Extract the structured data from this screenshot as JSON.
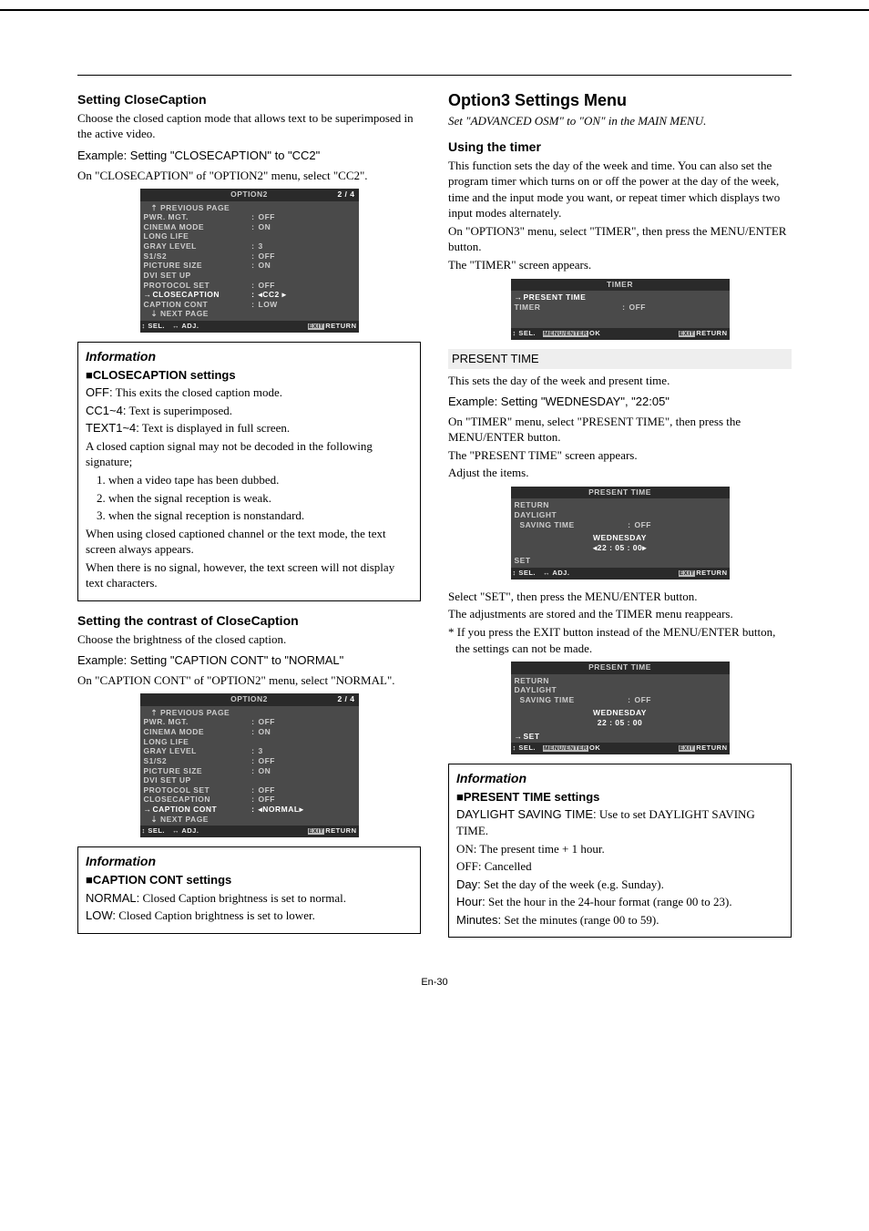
{
  "left": {
    "closeCaption": {
      "heading": "Setting CloseCaption",
      "intro": "Choose the closed caption mode that allows text to be superimposed in the active video.",
      "example": "Example: Setting \"CLOSECAPTION\" to \"CC2\"",
      "instruction": "On \"CLOSECAPTION\" of \"OPTION2\" menu, select \"CC2\"."
    },
    "osd1": {
      "title": "OPTION2",
      "page": "2 / 4",
      "prev": "PREVIOUS PAGE",
      "rows": [
        {
          "label": "PWR. MGT.",
          "val": "OFF"
        },
        {
          "label": "CINEMA MODE",
          "val": "ON"
        },
        {
          "label": "LONG LIFE",
          "val": ""
        },
        {
          "label": "GRAY LEVEL",
          "val": "3"
        },
        {
          "label": "S1/S2",
          "val": "OFF"
        },
        {
          "label": "PICTURE SIZE",
          "val": "ON"
        },
        {
          "label": "DVI SET UP",
          "val": ""
        },
        {
          "label": "PROTOCOL SET",
          "val": "OFF"
        },
        {
          "label": "CLOSECAPTION",
          "val": "◂CC2   ▸",
          "sel": true
        },
        {
          "label": "CAPTION CONT",
          "val": "LOW"
        }
      ],
      "next": "NEXT PAGE",
      "foot": {
        "sel": "SEL.",
        "adj": "ADJ.",
        "ret": "RETURN"
      }
    },
    "info1": {
      "title": "Information",
      "subtitle": "CLOSECAPTION settings",
      "l1a": "OFF:",
      "l1b": " This exits the closed caption mode.",
      "l2a": "CC1~4:",
      "l2b": " Text is superimposed.",
      "l3a": "TEXT1~4:",
      "l3b": " Text is displayed in full screen.",
      "l4": "A closed caption signal may not be decoded in the following signature;",
      "li1": "1. when a video tape has been dubbed.",
      "li2": "2. when the signal reception is weak.",
      "li3": "3. when the signal reception is nonstandard.",
      "l5": "When using closed captioned channel or the text mode, the text screen always appears.",
      "l6": "When there is no signal, however, the text screen will not display text characters."
    },
    "contrast": {
      "heading": "Setting the contrast of CloseCaption",
      "intro": "Choose the brightness of the closed caption.",
      "example": "Example: Setting \"CAPTION CONT\" to \"NORMAL\"",
      "instruction": "On \"CAPTION CONT\" of \"OPTION2\" menu, select \"NORMAL\"."
    },
    "osd2": {
      "title": "OPTION2",
      "page": "2 / 4",
      "prev": "PREVIOUS PAGE",
      "rows": [
        {
          "label": "PWR. MGT.",
          "val": "OFF"
        },
        {
          "label": "CINEMA MODE",
          "val": "ON"
        },
        {
          "label": "LONG LIFE",
          "val": ""
        },
        {
          "label": "GRAY LEVEL",
          "val": "3"
        },
        {
          "label": "S1/S2",
          "val": "OFF"
        },
        {
          "label": "PICTURE SIZE",
          "val": "ON"
        },
        {
          "label": "DVI SET UP",
          "val": ""
        },
        {
          "label": "PROTOCOL SET",
          "val": "OFF"
        },
        {
          "label": "CLOSECAPTION",
          "val": "OFF"
        },
        {
          "label": "CAPTION CONT",
          "val": "◂NORMAL▸",
          "sel": true
        }
      ],
      "next": "NEXT PAGE",
      "foot": {
        "sel": "SEL.",
        "adj": "ADJ.",
        "ret": "RETURN"
      }
    },
    "info2": {
      "title": "Information",
      "subtitle": "CAPTION CONT settings",
      "l1a": "NORMAL:",
      "l1b": " Closed Caption brightness is set to normal.",
      "l2a": "LOW:",
      "l2b": " Closed Caption brightness is set to lower."
    }
  },
  "right": {
    "menuTitle": "Option3 Settings Menu",
    "advanced": "Set \"ADVANCED OSM\" to \"ON\" in the MAIN MENU.",
    "timer": {
      "heading": "Using the timer",
      "p1": "This function sets the day of the week and time. You can also set the program timer which turns on or off the power at the day of the week, time and the input mode you want, or repeat timer which displays two input modes alternately.",
      "p2": "On \"OPTION3\" menu, select \"TIMER\", then press the MENU/ENTER button.",
      "p3": "The \"TIMER\" screen appears."
    },
    "osd3": {
      "title": "TIMER",
      "rows": [
        {
          "label": "PRESENT TIME",
          "sel": true
        },
        {
          "label": "TIMER",
          "val": "OFF"
        }
      ],
      "foot": {
        "sel": "SEL.",
        "ok": "OK",
        "ret": "RETURN"
      }
    },
    "presentHead": "PRESENT TIME",
    "present": {
      "p1": "This sets the day of the week and present time.",
      "example": "Example: Setting \"WEDNESDAY\", \"22:05\"",
      "p2": "On \"TIMER\" menu, select \"PRESENT TIME\", then press the MENU/ENTER button.",
      "p3": "The \"PRESENT TIME\" screen appears.",
      "p4": "Adjust the items."
    },
    "osd4": {
      "title": "PRESENT TIME",
      "return": "RETURN",
      "dl1": "DAYLIGHT",
      "dl2": "SAVING TIME",
      "dlval": "OFF",
      "day": "WEDNESDAY",
      "time": "◂22 : 05 : 00▸",
      "set": "SET",
      "foot": {
        "sel": "SEL.",
        "adj": "ADJ.",
        "ret": "RETURN"
      }
    },
    "afterOsd4": {
      "p1": "Select \"SET\", then press the MENU/ENTER button.",
      "p2": "The adjustments are stored and the TIMER menu reappears.",
      "p3": "* If you press the EXIT button instead of the MENU/ENTER button, the settings can not be made."
    },
    "osd5": {
      "title": "PRESENT TIME",
      "return": "RETURN",
      "dl1": "DAYLIGHT",
      "dl2": "SAVING TIME",
      "dlval": "OFF",
      "day": "WEDNESDAY",
      "time": "22 : 05 : 00",
      "set": "SET",
      "foot": {
        "sel": "SEL.",
        "ok": "OK",
        "ret": "RETURN"
      }
    },
    "info3": {
      "title": "Information",
      "subtitle": "PRESENT TIME settings",
      "l1a": "DAYLIGHT SAVING TIME:",
      "l1b": " Use to set DAYLIGHT SAVING TIME.",
      "l2": "ON:    The present time + 1 hour.",
      "l3": "OFF:   Cancelled",
      "l4a": "Day:",
      "l4b": " Set the day of the week (e.g. Sunday).",
      "l5a": "Hour:",
      "l5b": " Set the hour in the 24-hour format (range 00 to 23).",
      "l6a": "Minutes:",
      "l6b": " Set the minutes (range 00 to 59)."
    }
  },
  "footer": "En-30"
}
